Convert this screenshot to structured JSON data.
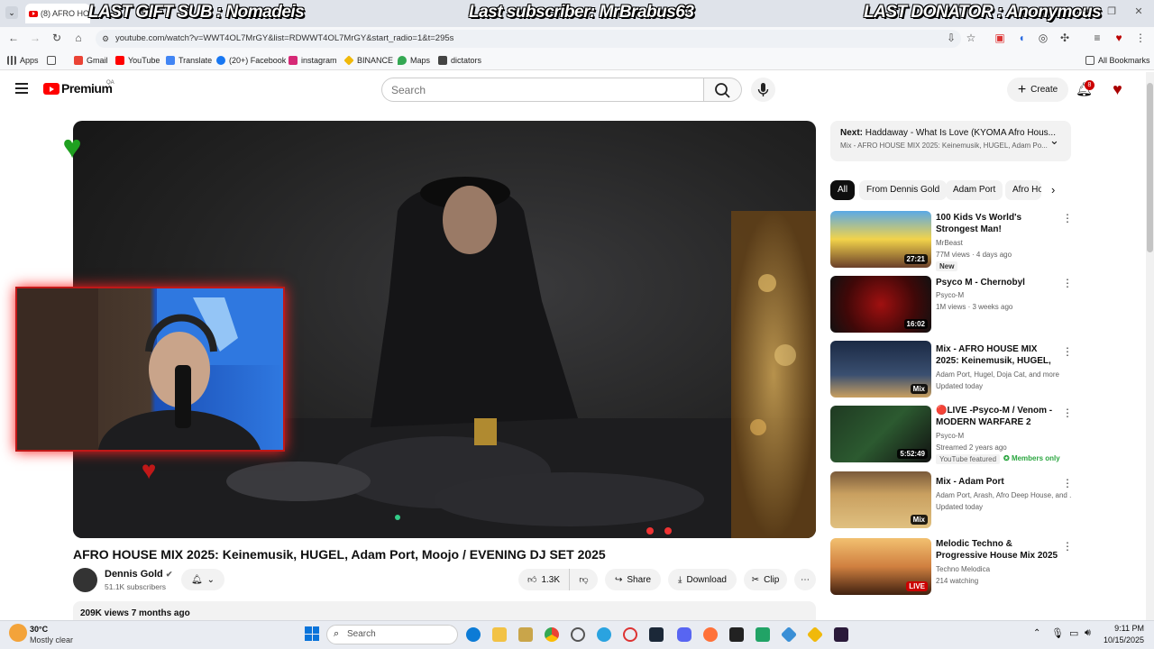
{
  "browser": {
    "tab_title": "(8) AFRO HOU",
    "url": "youtube.com/watch?v=WWT4OL7MrGY&list=RDWWT4OL7MrGY&start_radio=1&t=295s",
    "bookmarks": [
      "Apps",
      "Gmail",
      "YouTube",
      "Translate",
      "(20+) Facebook",
      "instagram",
      "BINANCE",
      "Maps",
      "dictators"
    ],
    "all_bookmarks": "All Bookmarks"
  },
  "stream_overlay": {
    "gift_sub": "LAST GIFT SUB : Nomadeis",
    "subscriber": "Last subscriber: MrBrabus63",
    "donator": "LAST DONATOR : Anonymous"
  },
  "youtube": {
    "logo": "Premium",
    "logo_sup": "QA",
    "search_placeholder": "Search",
    "create_label": "Create",
    "notif_count": "8"
  },
  "video": {
    "title": "AFRO HOUSE MIX 2025: Keinemusik, HUGEL, Adam Port, Moojo / EVENING DJ SET 2025",
    "channel": "Dennis Gold",
    "subscribers": "51.1K subscribers",
    "likes": "1.3K",
    "share": "Share",
    "download": "Download",
    "clip": "Clip",
    "views_date": "209K views  7 months ago"
  },
  "next_up": {
    "label": "Next:",
    "title": "Haddaway - What Is Love (KYOMA Afro Hous...",
    "subtitle": "Mix - AFRO HOUSE MIX 2025: Keinemusik, HUGEL, Adam Po..."
  },
  "chips": [
    "All",
    "From Dennis Gold",
    "Adam Port",
    "Afro Ho"
  ],
  "recommendations": [
    {
      "title": "100 Kids Vs World's Strongest Man!",
      "channel": "MrBeast",
      "meta": "77M views · 4 days ago",
      "badge": "New",
      "duration": "27:21"
    },
    {
      "title": "Psyco M -  Chernobyl",
      "channel": "Psyco-M",
      "meta": "1M views · 3 weeks ago",
      "badge": "",
      "duration": "16:02"
    },
    {
      "title": "Mix - AFRO HOUSE MIX 2025: Keinemusik, HUGEL, Adam Po...",
      "channel": "Adam Port, Hugel, Doja Cat, and more",
      "meta": "Updated today",
      "badge": "",
      "duration": "Mix"
    },
    {
      "title": "🔴LIVE -Psyco-M / Venom  - MODERN WARFARE 2",
      "channel": "Psyco-M",
      "meta": "Streamed 2 years ago",
      "badge": "YouTube featured",
      "badge2": "Members only",
      "duration": "5:52:49"
    },
    {
      "title": "Mix - Adam Port",
      "channel": "Adam Port, Arash, Afro Deep House, and ...",
      "meta": "Updated today",
      "badge": "",
      "duration": "Mix"
    },
    {
      "title": "Melodic Techno & Progressive House Mix 2025 | Deep, ...",
      "channel": "Techno Melodica",
      "meta": "214 watching",
      "badge": "",
      "duration": "LIVE"
    }
  ],
  "taskbar": {
    "weather_temp": "30°C",
    "weather_desc": "Mostly clear",
    "search": "Search",
    "time": "9:11 PM",
    "date": "10/15/2025"
  }
}
